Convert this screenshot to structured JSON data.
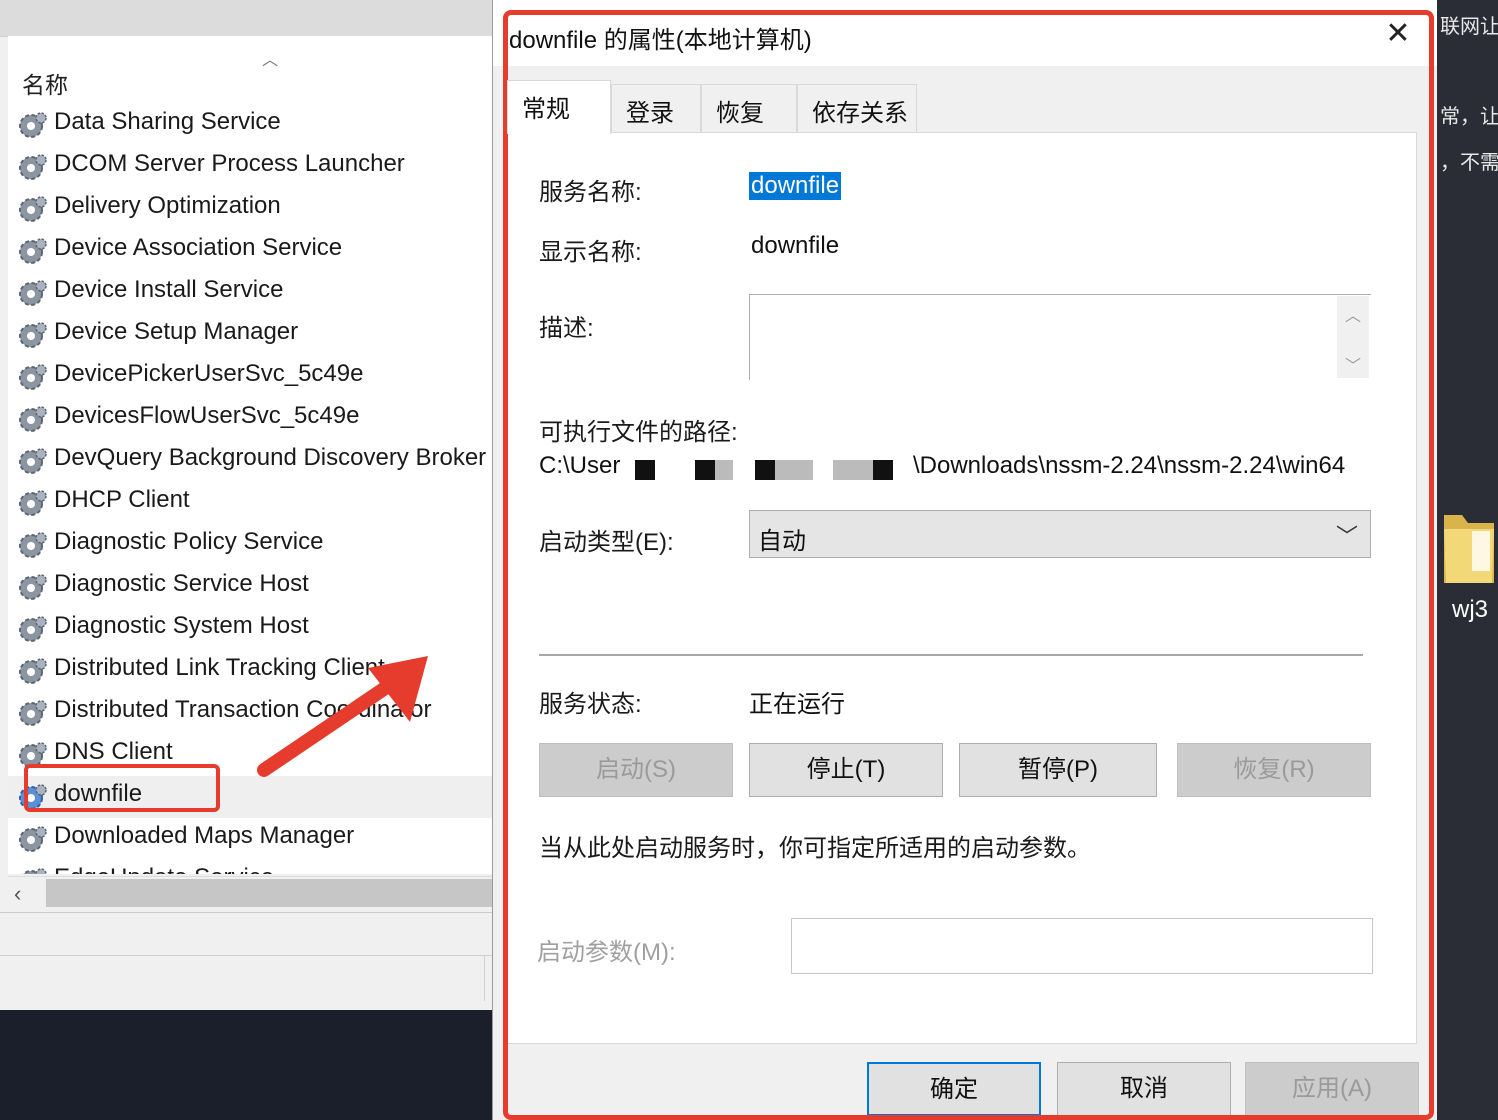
{
  "background": {
    "right_text_lines": [
      "联网让",
      "常，让",
      "，不需"
    ],
    "desktop_folder_label": "wj3"
  },
  "services_panel": {
    "column_header": "名称",
    "items": [
      {
        "name": "Data Sharing Service"
      },
      {
        "name": "DCOM Server Process Launcher"
      },
      {
        "name": "Delivery Optimization"
      },
      {
        "name": "Device Association Service"
      },
      {
        "name": "Device Install Service"
      },
      {
        "name": "Device Setup Manager"
      },
      {
        "name": "DevicePickerUserSvc_5c49e"
      },
      {
        "name": "DevicesFlowUserSvc_5c49e"
      },
      {
        "name": "DevQuery Background Discovery Broker"
      },
      {
        "name": "DHCP Client"
      },
      {
        "name": "Diagnostic Policy Service"
      },
      {
        "name": "Diagnostic Service Host"
      },
      {
        "name": "Diagnostic System Host"
      },
      {
        "name": "Distributed Link Tracking Client"
      },
      {
        "name": "Distributed Transaction Coordinator"
      },
      {
        "name": "DNS Client"
      },
      {
        "name": "downfile",
        "selected": true
      },
      {
        "name": "Downloaded Maps Manager"
      },
      {
        "name": "EdgeUpdate Service"
      }
    ]
  },
  "dialog": {
    "title": "downfile 的属性(本地计算机)",
    "close_label": "✕",
    "tabs": [
      {
        "label": "常规",
        "active": true
      },
      {
        "label": "登录"
      },
      {
        "label": "恢复"
      },
      {
        "label": "依存关系"
      }
    ],
    "general": {
      "service_name_label": "服务名称:",
      "service_name_value": "downfile",
      "display_name_label": "显示名称:",
      "display_name_value": "downfile",
      "description_label": "描述:",
      "description_value": "",
      "path_label": "可执行文件的路径:",
      "path_prefix": "C:\\User",
      "path_suffix": "\\Downloads\\nssm-2.24\\nssm-2.24\\win64",
      "startup_type_label": "启动类型(E):",
      "startup_type_value": "自动",
      "status_label": "服务状态:",
      "status_value": "正在运行",
      "buttons": {
        "start": "启动(S)",
        "stop": "停止(T)",
        "pause": "暂停(P)",
        "resume": "恢复(R)"
      },
      "hint": "当从此处启动服务时，你可指定所适用的启动参数。",
      "params_label": "启动参数(M):",
      "params_value": ""
    },
    "footer": {
      "ok": "确定",
      "cancel": "取消",
      "apply": "应用(A)"
    }
  },
  "colors": {
    "annotation": "#e63c2e",
    "selection": "#0078d7",
    "default_button_border": "#0078d7"
  }
}
